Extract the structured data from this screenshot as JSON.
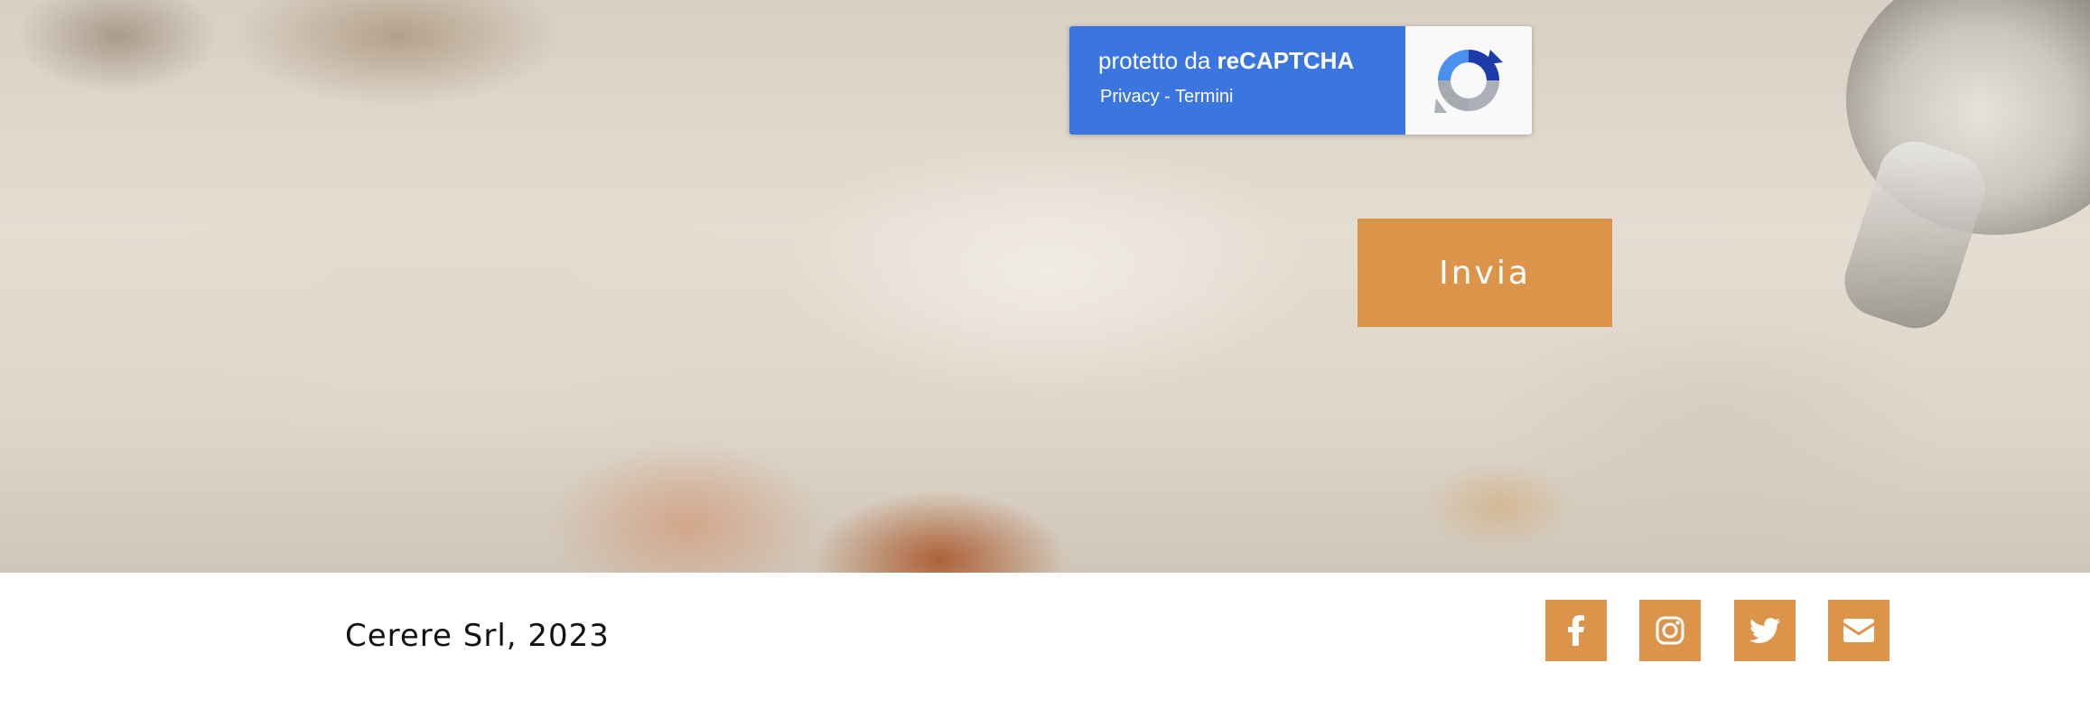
{
  "recaptcha": {
    "protected_prefix": "protetto da ",
    "brand": "reCAPTCHA",
    "privacy_link": "Privacy",
    "separator": " - ",
    "terms_link": "Termini"
  },
  "form": {
    "submit_label": "Invia"
  },
  "footer": {
    "copyright": "Cerere Srl, 2023",
    "social_links": [
      {
        "icon": "facebook-icon"
      },
      {
        "icon": "instagram-icon"
      },
      {
        "icon": "twitter-icon"
      },
      {
        "icon": "envelope-icon"
      }
    ]
  },
  "colors": {
    "accent": "#dc944a",
    "recaptcha_blue": "#3b76e0"
  }
}
